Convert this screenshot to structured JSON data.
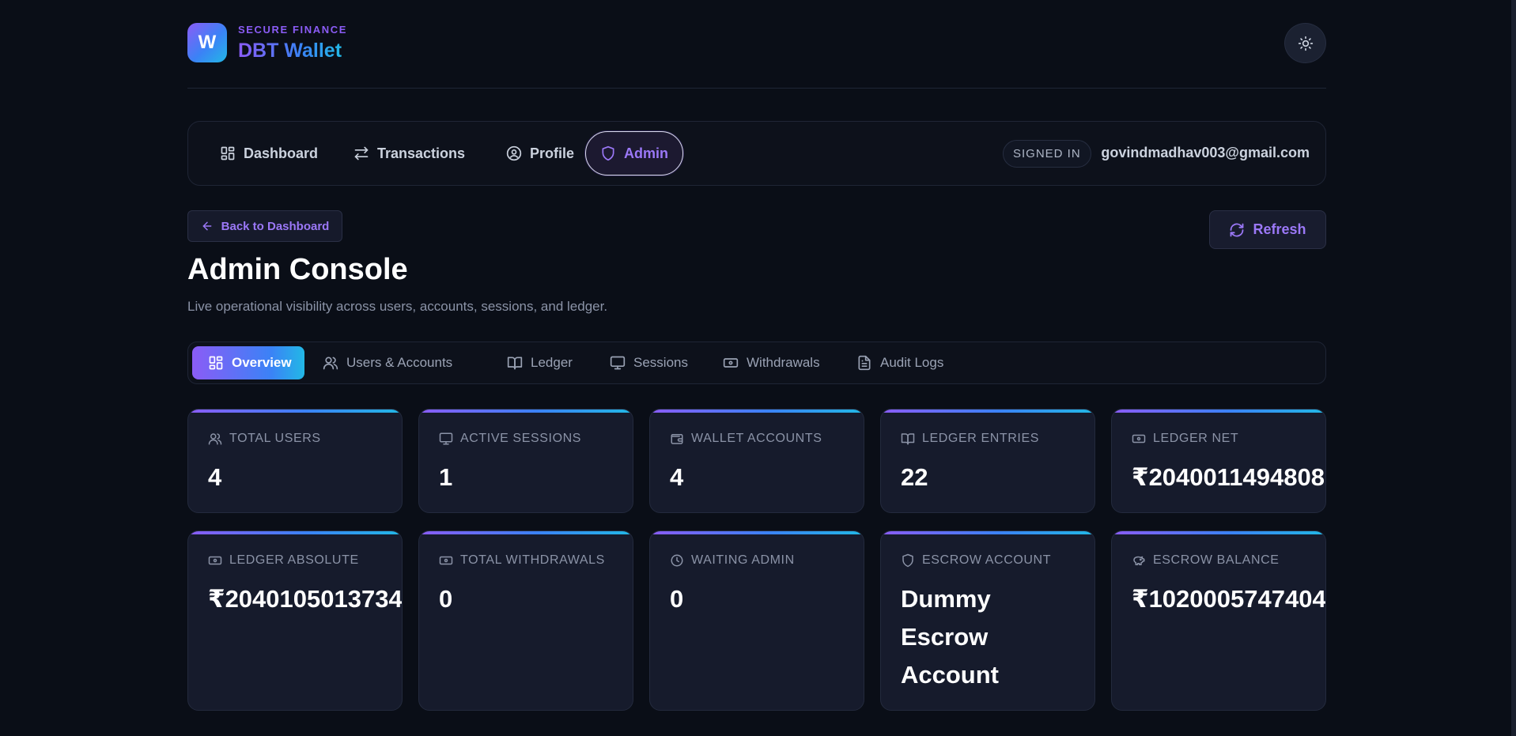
{
  "brand": {
    "logo_letter": "W",
    "eyebrow": "SECURE FINANCE",
    "title": "DBT Wallet"
  },
  "header": {
    "theme_icon": "sun-icon"
  },
  "nav": {
    "items": [
      {
        "label": "Dashboard",
        "icon": "dashboard-icon"
      },
      {
        "label": "Transactions",
        "icon": "arrows-icon"
      },
      {
        "label": "Profile",
        "icon": "user-circle-icon"
      },
      {
        "label": "Admin",
        "icon": "shield-icon",
        "active": true
      }
    ],
    "signed_in_badge": "SIGNED IN",
    "user_email": "govindmadhav003@gmail.com"
  },
  "page": {
    "back_label": "Back to Dashboard",
    "refresh_label": "Refresh",
    "title": "Admin Console",
    "subtitle": "Live operational visibility across users, accounts, sessions, and ledger."
  },
  "tabs": [
    {
      "label": "Overview",
      "icon": "grid-icon",
      "active": true
    },
    {
      "label": "Users & Accounts",
      "icon": "users-icon"
    },
    {
      "label": "Ledger",
      "icon": "book-icon"
    },
    {
      "label": "Sessions",
      "icon": "monitor-icon"
    },
    {
      "label": "Withdrawals",
      "icon": "banknote-icon"
    },
    {
      "label": "Audit Logs",
      "icon": "file-text-icon"
    }
  ],
  "stats": [
    {
      "label": "TOTAL USERS",
      "value": "4",
      "icon": "users-icon"
    },
    {
      "label": "ACTIVE SESSIONS",
      "value": "1",
      "icon": "monitor-icon"
    },
    {
      "label": "WALLET ACCOUNTS",
      "value": "4",
      "icon": "wallet-icon"
    },
    {
      "label": "LEDGER ENTRIES",
      "value": "22",
      "icon": "book-icon"
    },
    {
      "label": "LEDGER NET",
      "value": "₹2040011494808",
      "icon": "banknote-icon"
    },
    {
      "label": "LEDGER ABSOLUTE",
      "value": "₹2040105013734",
      "icon": "banknote-icon"
    },
    {
      "label": "TOTAL WITHDRAWALS",
      "value": "0",
      "icon": "banknote-icon"
    },
    {
      "label": "WAITING ADMIN",
      "value": "0",
      "icon": "clock-icon"
    },
    {
      "label": "ESCROW ACCOUNT",
      "value": "Dummy Escrow Account",
      "icon": "shield-icon"
    },
    {
      "label": "ESCROW BALANCE",
      "value": "₹1020005747404",
      "icon": "piggy-bank-icon"
    }
  ],
  "colors": {
    "background": "#0a0e17",
    "accent": "#8b5cf6",
    "accent_secondary": "#22b8e6",
    "card": "#161b2c"
  }
}
